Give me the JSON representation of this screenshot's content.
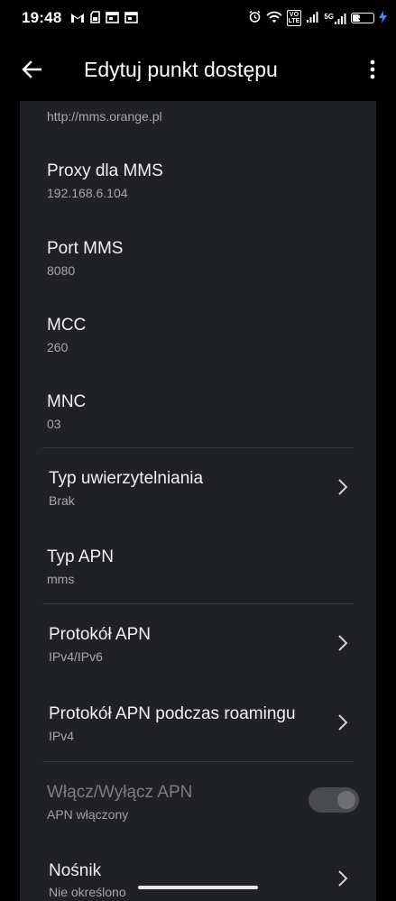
{
  "status_bar": {
    "time": "19:48",
    "left_icons": [
      "gmail-icon",
      "sd-card-icon",
      "calendar-icon",
      "calendar-icon"
    ],
    "right_icons": [
      "alarm-icon",
      "wifi-icon",
      "volte-icon",
      "signal-icon",
      "signal-5g-icon"
    ],
    "network": "5G",
    "battery": "35",
    "battery_level": 0.35,
    "charging": true
  },
  "app_bar": {
    "title": "Edytuj punkt dostępu",
    "back_icon": "back-arrow-icon",
    "menu_icon": "more-vert-icon"
  },
  "settings": {
    "mmsc_value": "http://mms.orange.pl",
    "mms_proxy": {
      "title": "Proxy dla MMS",
      "value": "192.168.6.104"
    },
    "mms_port": {
      "title": "Port MMS",
      "value": "8080"
    },
    "mcc": {
      "title": "MCC",
      "value": "260"
    },
    "mnc": {
      "title": "MNC",
      "value": "03"
    },
    "auth_type": {
      "title": "Typ uwierzytelniania",
      "value": "Brak"
    },
    "apn_type": {
      "title": "Typ APN",
      "value": "mms"
    },
    "apn_protocol": {
      "title": "Protokół APN",
      "value": "IPv4/IPv6"
    },
    "apn_roaming_protocol": {
      "title": "Protokół APN podczas roamingu",
      "value": "IPv4"
    },
    "apn_enable": {
      "title": "Włącz/Wyłącz APN",
      "value": "APN włączony",
      "enabled": true,
      "disabled": true
    },
    "bearer": {
      "title": "Nośnik",
      "value": "Nie określono"
    }
  },
  "colors": {
    "background": "#000000",
    "card": "#202124",
    "text_primary": "#f1f1f1",
    "text_secondary": "#a8a8a8",
    "charging_bolt": "#3d8bff"
  }
}
